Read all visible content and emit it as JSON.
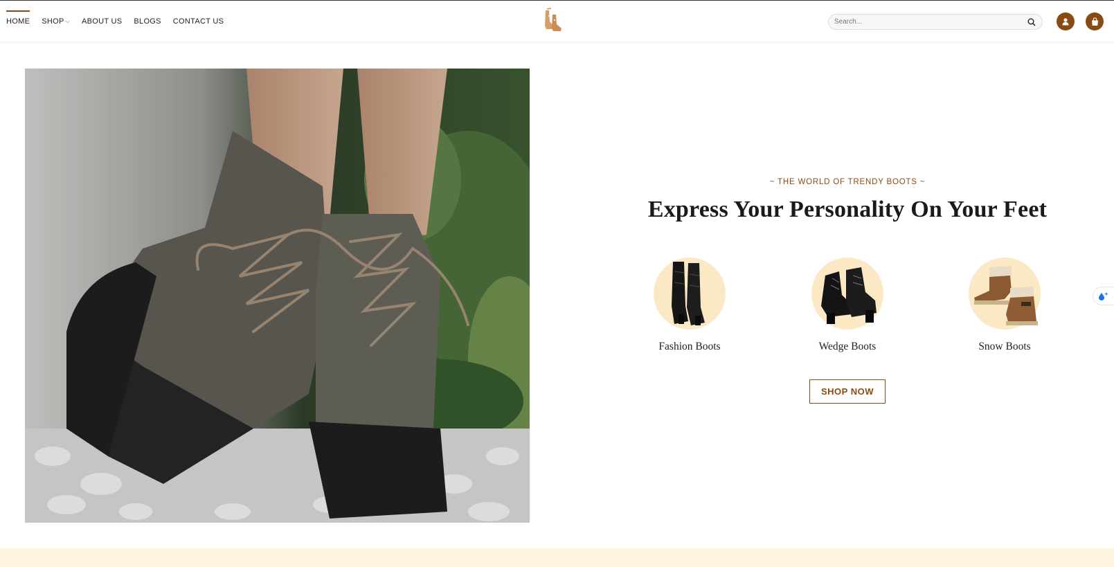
{
  "nav": {
    "items": [
      {
        "label": "HOME",
        "active": true
      },
      {
        "label": "SHOP",
        "dropdown": true
      },
      {
        "label": "ABOUT US"
      },
      {
        "label": "BLOGS"
      },
      {
        "label": "CONTACT US"
      }
    ]
  },
  "search": {
    "placeholder": "Search..."
  },
  "hero": {
    "tagline": "~ THE WORLD OF TRENDY BOOTS ~",
    "headline": "Express Your Personality On Your Feet",
    "categories": [
      {
        "label": "Fashion Boots",
        "icon": "tall-boots-icon"
      },
      {
        "label": "Wedge Boots",
        "icon": "ankle-boots-icon"
      },
      {
        "label": "Snow Boots",
        "icon": "snow-boots-icon"
      }
    ],
    "cta": "SHOP NOW"
  },
  "colors": {
    "accent": "#8a4b12",
    "cream": "#fbe9c5",
    "band": "#fdf3de"
  }
}
